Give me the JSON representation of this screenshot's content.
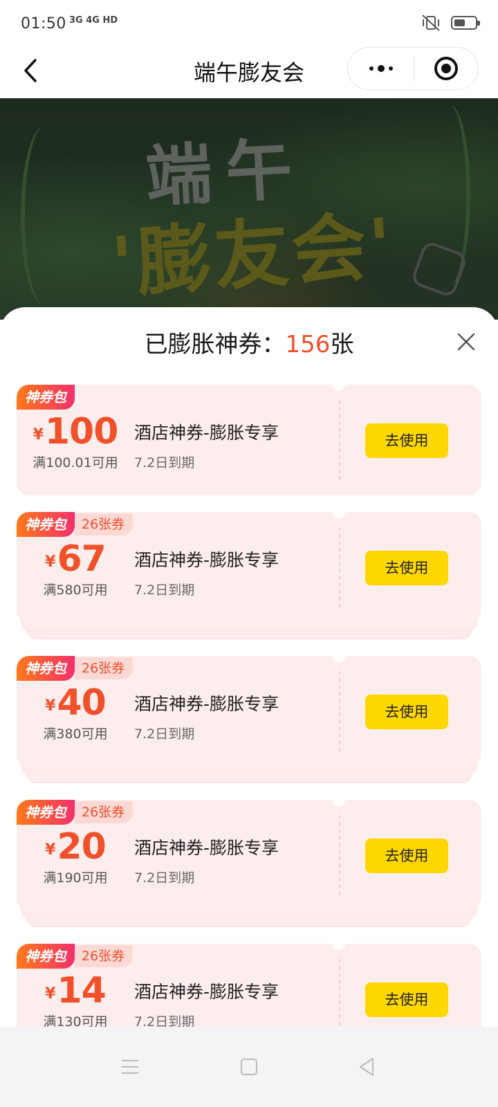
{
  "status_bar": {
    "time": "01:50",
    "network": "3G 4G HD"
  },
  "header": {
    "title": "端午膨友会"
  },
  "banner": {
    "line1": "端午",
    "line2": "'膨友会'"
  },
  "sheet": {
    "title_prefix": "已膨胀神券：",
    "count": "156",
    "title_suffix": "张"
  },
  "coupons": [
    {
      "tag": "神券包",
      "count_label": "",
      "currency": "¥",
      "amount": "100",
      "condition": "满100.01可用",
      "name": "酒店神券-膨胀专享",
      "expiry": "7.2日到期",
      "button": "去使用"
    },
    {
      "tag": "神券包",
      "count_label": "26张券",
      "currency": "¥",
      "amount": "67",
      "condition": "满580可用",
      "name": "酒店神券-膨胀专享",
      "expiry": "7.2日到期",
      "button": "去使用"
    },
    {
      "tag": "神券包",
      "count_label": "26张券",
      "currency": "¥",
      "amount": "40",
      "condition": "满380可用",
      "name": "酒店神券-膨胀专享",
      "expiry": "7.2日到期",
      "button": "去使用"
    },
    {
      "tag": "神券包",
      "count_label": "26张券",
      "currency": "¥",
      "amount": "20",
      "condition": "满190可用",
      "name": "酒店神券-膨胀专享",
      "expiry": "7.2日到期",
      "button": "去使用"
    },
    {
      "tag": "神券包",
      "count_label": "26张券",
      "currency": "¥",
      "amount": "14",
      "condition": "满130可用",
      "name": "酒店神券-膨胀专享",
      "expiry": "7.2日到期",
      "button": "去使用"
    }
  ],
  "colors": {
    "accent": "#f0502a",
    "button": "#ffd700",
    "card_bg": "#fdeeed"
  },
  "icons": {
    "back": "chevron-left-icon",
    "more": "more-dots-icon",
    "target": "target-icon",
    "close": "close-icon",
    "nav_menu": "menu-icon",
    "nav_home": "square-icon",
    "nav_back": "triangle-back-icon"
  }
}
